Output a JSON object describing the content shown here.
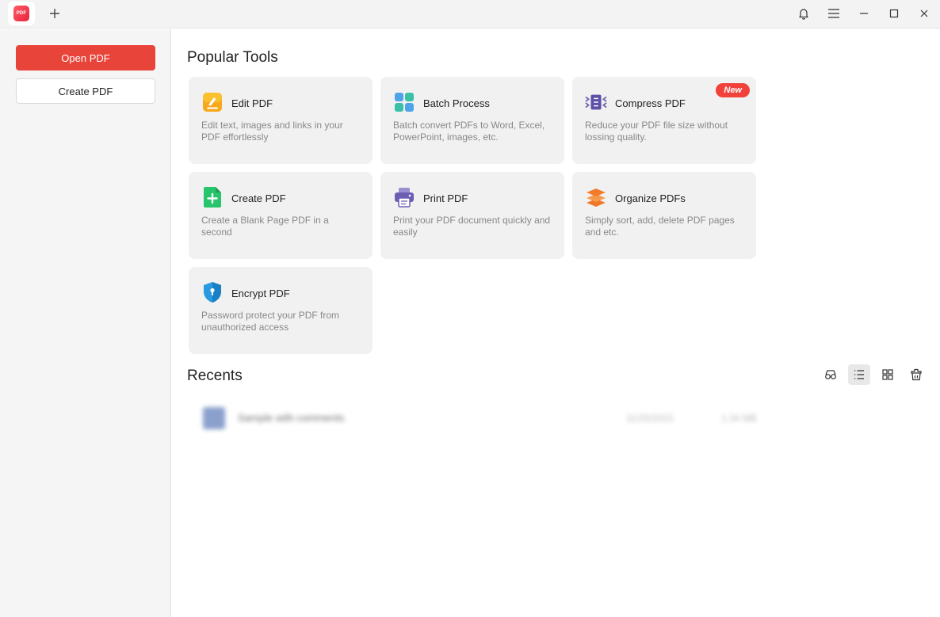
{
  "titlebar": {
    "logo_text": "PDF",
    "icons": [
      "plus-icon",
      "bell-icon",
      "menu-icon",
      "minimize-icon",
      "maximize-icon",
      "close-icon"
    ]
  },
  "sidebar": {
    "open_label": "Open PDF",
    "create_label": "Create PDF"
  },
  "main": {
    "popular_title": "Popular Tools",
    "tools": [
      {
        "title": "Edit PDF",
        "desc": "Edit text, images and links in your PDF effortlessly",
        "icon": "edit-pdf-icon"
      },
      {
        "title": "Batch Process",
        "desc": "Batch convert PDFs to Word, Excel, PowerPoint, images, etc.",
        "icon": "batch-process-icon"
      },
      {
        "title": "Compress PDF",
        "desc": "Reduce your PDF file size without lossing quality.",
        "icon": "compress-pdf-icon",
        "badge": "New"
      },
      {
        "title": "Create PDF",
        "desc": "Create a Blank Page PDF in a second",
        "icon": "create-pdf-icon"
      },
      {
        "title": "Print PDF",
        "desc": "Print your PDF document quickly and easily",
        "icon": "print-pdf-icon"
      },
      {
        "title": "Organize PDFs",
        "desc": "Simply sort, add, delete PDF pages and etc.",
        "icon": "organize-pdfs-icon"
      },
      {
        "title": "Encrypt PDF",
        "desc": "Password protect your PDF from unauthorized access",
        "icon": "encrypt-pdf-icon"
      }
    ],
    "recents_title": "Recents",
    "recents": [
      {
        "name": "Sample with comments",
        "date": "11/25/2023",
        "size": "1.34 MB"
      }
    ]
  },
  "colors": {
    "accent": "#e8443a",
    "badge": "#f0413a",
    "card_bg": "#f1f1f1",
    "sidebar_bg": "#f5f5f5"
  }
}
